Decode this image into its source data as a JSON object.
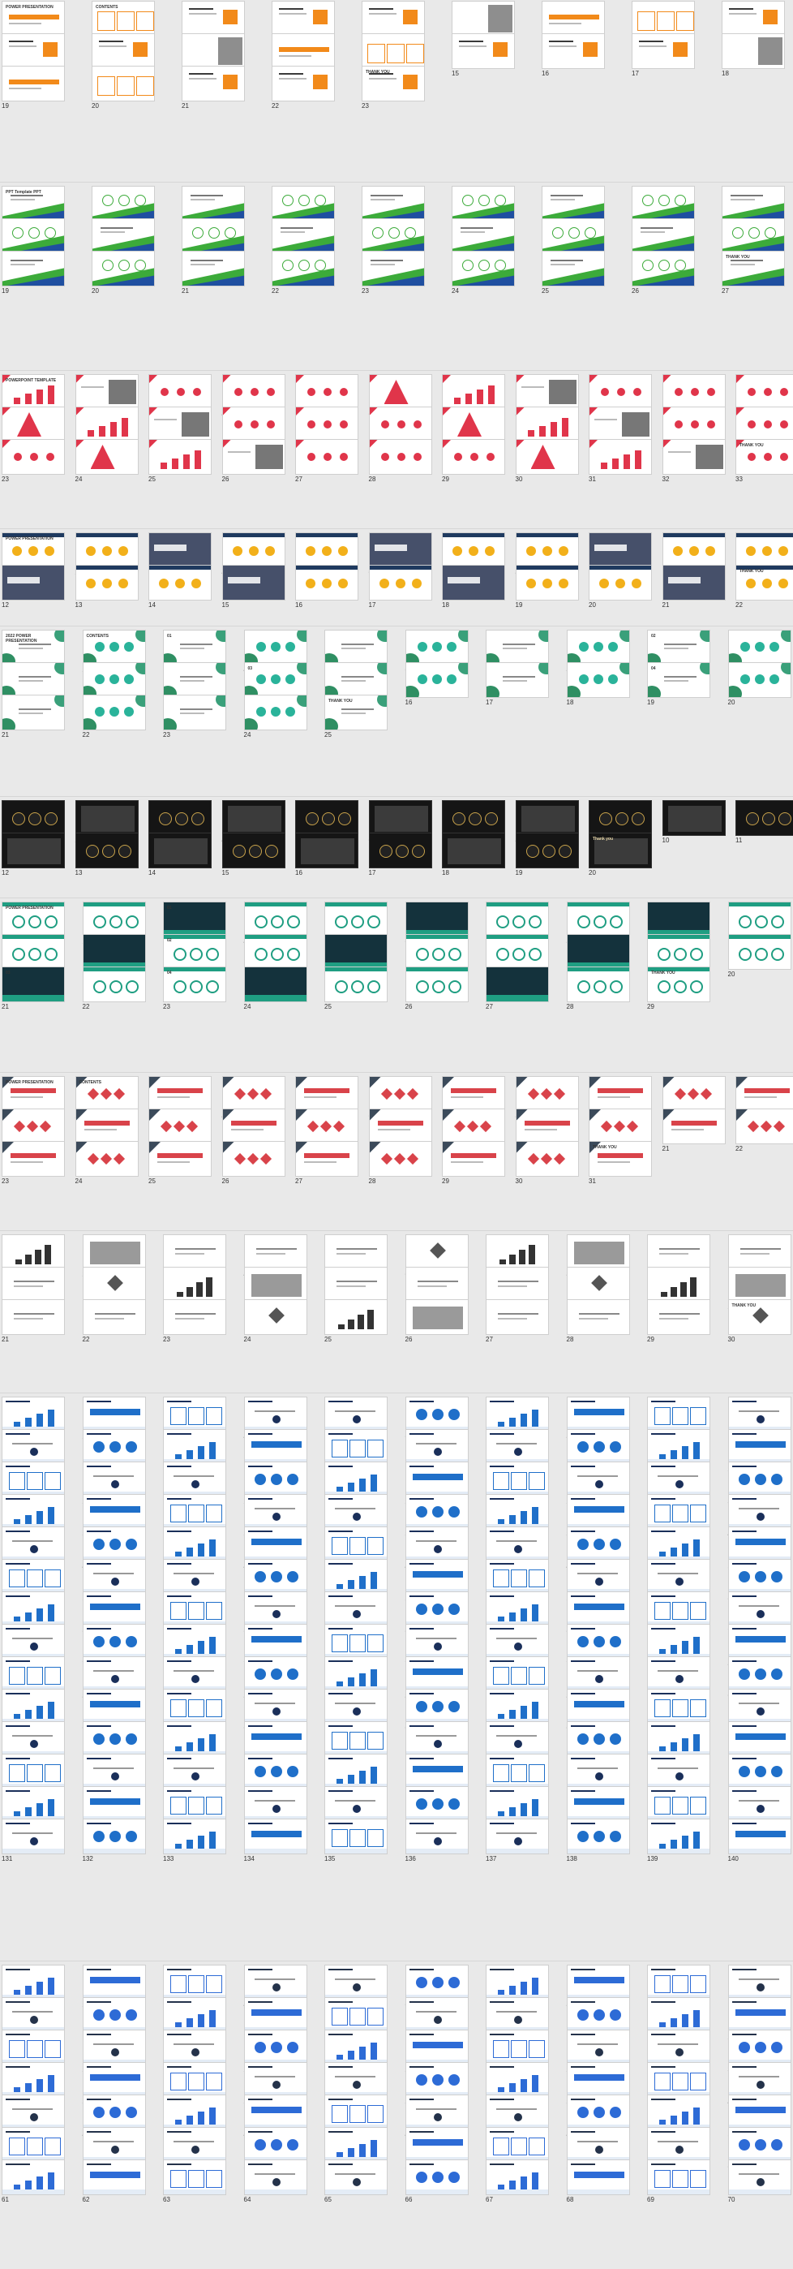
{
  "decks": [
    {
      "name": "deck-orange",
      "theme": "orange",
      "columns": 9,
      "count": 23,
      "accent": "#f28a1a",
      "dark": "#3a3a3a",
      "labels": {
        "1": "POWER PRESENTATION",
        "2": "CONTENTS",
        "23": "THANK YOU"
      }
    },
    {
      "name": "deck-green-wave",
      "theme": "green-wave",
      "columns": 9,
      "count": 27,
      "accent": "#3cab3a",
      "dark": "#1f4fa0",
      "labels": {
        "1": "PPT Template PPT",
        "27": "THANK YOU"
      }
    },
    {
      "name": "deck-red-triangle",
      "theme": "red",
      "columns": 11,
      "count": 33,
      "accent": "#e0354a",
      "dark": "#444444",
      "labels": {
        "1": "POWERPOINT TEMPLATE",
        "33": "THANK YOU"
      }
    },
    {
      "name": "deck-navy-photo",
      "theme": "navy",
      "columns": 11,
      "count": 22,
      "accent": "#f2b01a",
      "dark": "#1f3a5f",
      "labels": {
        "1": "POWER PRESENTATION",
        "22": "THANK YOU"
      }
    },
    {
      "name": "deck-teal-leaf",
      "theme": "teal",
      "columns": 10,
      "count": 25,
      "accent": "#2ab39a",
      "dark": "#1b6d5f",
      "labels": {
        "1": "2022 POWER PRESENTATION",
        "2": "CONTENTS",
        "3": "01",
        "9": "02",
        "14": "03",
        "19": "04",
        "25": "THANK YOU"
      }
    },
    {
      "name": "deck-black",
      "theme": "black",
      "columns": 11,
      "count": 20,
      "accent": "#c8a24a",
      "dark": "#111111",
      "labels": {
        "20": "Thank you"
      }
    },
    {
      "name": "deck-teal-dark",
      "theme": "teal-dark",
      "columns": 10,
      "count": 29,
      "accent": "#1f9e82",
      "dark": "#14323c",
      "labels": {
        "1": "POWER PRESENTATION",
        "3": "01",
        "13": "02",
        "21": "03",
        "23": "04",
        "29": "THANK YOU"
      }
    },
    {
      "name": "deck-red-geo",
      "theme": "red-geo",
      "columns": 11,
      "count": 31,
      "accent": "#d9434a",
      "dark": "#3b4a5a",
      "labels": {
        "1": "POWER PRESENTATION",
        "2": "CONTENTS",
        "31": "THANK YOU"
      }
    },
    {
      "name": "deck-gray-minimal",
      "theme": "gray",
      "columns": 10,
      "count": 30,
      "accent": "#555555",
      "dark": "#222222",
      "labels": {
        "30": "THANK YOU"
      }
    },
    {
      "name": "deck-blue-infographic",
      "theme": "blue",
      "columns": 10,
      "count": 140,
      "accent": "#1f6fc9",
      "dark": "#1a2f5a",
      "labels": {}
    },
    {
      "name": "deck-blue-infographic-2",
      "theme": "blue2",
      "columns": 10,
      "count": 70,
      "accent": "#2d6bd6",
      "dark": "#24324a",
      "labels": {}
    }
  ]
}
